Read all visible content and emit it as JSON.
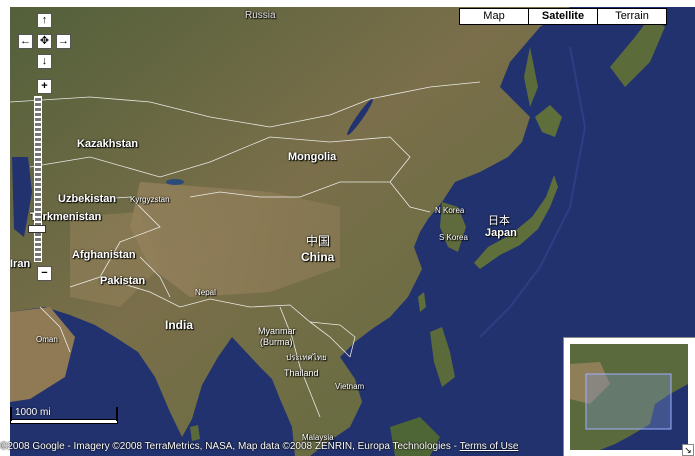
{
  "map_types": [
    {
      "label": "Map",
      "active": false
    },
    {
      "label": "Satellite",
      "active": true
    },
    {
      "label": "Terrain",
      "active": false
    }
  ],
  "nav": {
    "up": "↑",
    "down": "↓",
    "left": "←",
    "right": "→",
    "center": "✥",
    "zoom_in": "+",
    "zoom_out": "−"
  },
  "labels": {
    "russia": "Russia",
    "kazakhstan": "Kazakhstan",
    "mongolia": "Mongolia",
    "uzbekistan": "Uzbekistan",
    "kyrgyzstan": "Kyrgyzstan",
    "turkmenistan": "Turkmenistan",
    "afghanistan": "Afghanistan",
    "pakistan": "Pakistan",
    "iran": "Iran",
    "china_native": "中国",
    "china": "China",
    "nepal": "Nepal",
    "india": "India",
    "oman": "Oman",
    "myanmar": "Myanmar",
    "burma": "(Burma)",
    "thailand_native": "ประเทศไทย",
    "thailand": "Thailand",
    "vietnam": "Vietnam",
    "malaysia": "Malaysia",
    "n_korea": "N Korea",
    "s_korea": "S Korea",
    "japan_native": "日本",
    "japan": "Japan"
  },
  "scale": {
    "label": "1000 mi"
  },
  "attribution": {
    "text": "©2008 Google - Imagery ©2008 TerraMetrics, NASA, Map data ©2008 ZENRIN, Europa Technologies - ",
    "terms": "Terms of Use"
  },
  "overview": {
    "toggle": "↘"
  },
  "colors": {
    "ocean": "#22326e",
    "land": "#6c6a44",
    "border": "#ffffff",
    "accent": "#d9a24a"
  }
}
